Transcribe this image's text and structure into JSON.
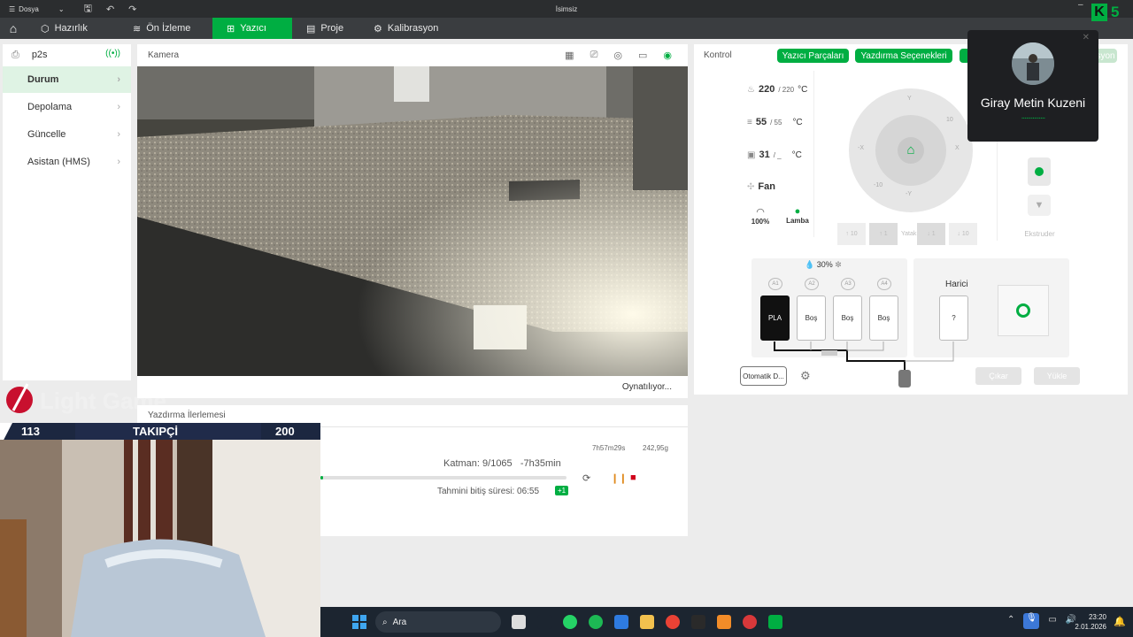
{
  "titlebar": {
    "menu_label": "Dosya",
    "title": "İsimsiz"
  },
  "nav": {
    "tabs": [
      "Hazırlık",
      "Ön İzleme",
      "Yazıcı",
      "Proje",
      "Kalibrasyon"
    ]
  },
  "sidebar": {
    "device": "p2s",
    "items": [
      "Durum",
      "Depolama",
      "Güncelle",
      "Asistan (HMS)"
    ]
  },
  "camera": {
    "header": "Kamera",
    "status": "Oynatılıyor..."
  },
  "print_progress": {
    "header": "Yazdırma İlerlemesi",
    "remaining_total": "7h57m29s",
    "weight": "242,95g",
    "layer": "Katman: 9/1065",
    "remaining": "-7h35min",
    "eta": "Tahmini bitiş süresi: 06:55",
    "eta_badge": "+1",
    "progress_fraction": 0.01
  },
  "control": {
    "header": "Kontrol",
    "buttons": [
      "Yazıcı Parçaları",
      "Yazdırma Seçenekleri"
    ],
    "hidden_button_fragment": "syon",
    "nozzle": {
      "value": "220",
      "target": "/ 220",
      "unit": "°C"
    },
    "bed": {
      "value": "55",
      "target": "/ 55",
      "unit": "°C"
    },
    "chamber": {
      "value": "31",
      "target": "/ _",
      "unit": "°C"
    },
    "fan_label": "Fan",
    "speed_label": "100%",
    "lamp_label": "Lamba",
    "jog": {
      "y": "Y",
      "neg_y": "-Y",
      "x": "X",
      "neg_x": "-X",
      "plus10": "10",
      "plus1": "1",
      "minus1": "-1",
      "minus10": "-10"
    },
    "bed_buttons": [
      "10",
      "1",
      "Yatak",
      "1",
      "10"
    ],
    "extruder_label": "Ekstruder"
  },
  "ams": {
    "humidity": "30%",
    "slot_labels": [
      "A1",
      "A2",
      "A3",
      "A4"
    ],
    "slots": [
      "PLA",
      "Boş",
      "Boş",
      "Boş"
    ],
    "external_label": "Harici",
    "external_slot": "?",
    "auto_button": "Otomatik D...",
    "unload": "Çıkar",
    "load": "Yükle"
  },
  "popup": {
    "name": "Giray Metin Kuzeni",
    "dots": "..............."
  },
  "brand": {
    "number": "5"
  },
  "overlay": {
    "left_count": "113",
    "follow_label": "TAKIPÇİ",
    "right_count": "200"
  },
  "taskbar": {
    "search_placeholder": "Ara",
    "time": "23:20",
    "date": "2.01.2026"
  },
  "colors": {
    "accent": "#00ae42",
    "titlebar": "#2b2d2f",
    "navbar": "#3a3d40"
  }
}
